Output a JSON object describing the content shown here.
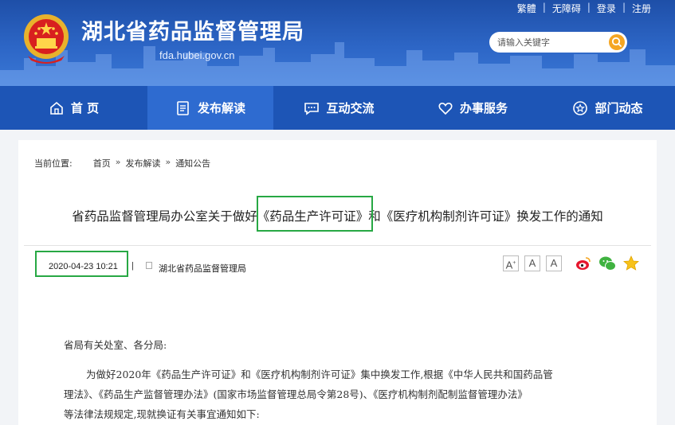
{
  "header": {
    "site_title": "湖北省药品监督管理局",
    "site_domain": "fda.hubei.gov.cn",
    "toplinks": [
      "繁體",
      "无障碍",
      "登录",
      "注册"
    ],
    "search_placeholder": "请输入关键字"
  },
  "nav": {
    "items": [
      {
        "label": "首 页",
        "icon": "home-icon"
      },
      {
        "label": "发布解读",
        "icon": "document-icon"
      },
      {
        "label": "互动交流",
        "icon": "chat-icon"
      },
      {
        "label": "办事服务",
        "icon": "heart-icon"
      },
      {
        "label": "部门动态",
        "icon": "star-icon"
      }
    ],
    "active_index": 1
  },
  "breadcrumb": {
    "prefix": "当前位置:",
    "items": [
      "首页",
      "发布解读",
      "通知公告"
    ],
    "separator": "»"
  },
  "article": {
    "title_pre": "省药品监督管理局办公室关于做好",
    "title_hl": "《药品生产许可证》",
    "title_post": "和《医疗机构制剂许可证》换发工作的通知",
    "date": "2020-04-23 10:21",
    "meta_sep": "|",
    "source": "湖北省药品监督管理局",
    "font_sizes": [
      "A",
      "A",
      "A"
    ],
    "share_icons": [
      "weibo-icon",
      "wechat-icon",
      "favorite-star-icon"
    ],
    "salutation": "省局有关处室、各分局:",
    "para1_line1": "为做好2020年《药品生产许可证》和《医疗机构制剂许可证》集中换发工作,根据《中华人民共和国药品管",
    "para1_line2": "理法》、《药品生产监督管理办法》(国家市场监督管理总局令第28号)、《医疗机构制剂配制监督管理办法》",
    "para1_line3": "等法律法规规定,现就换证有关事宜通知如下:"
  },
  "colors": {
    "header_blue": "#1e4fa8",
    "nav_blue": "#1d55b6",
    "highlight_green": "#27a844",
    "search_orange": "#f5a623"
  }
}
